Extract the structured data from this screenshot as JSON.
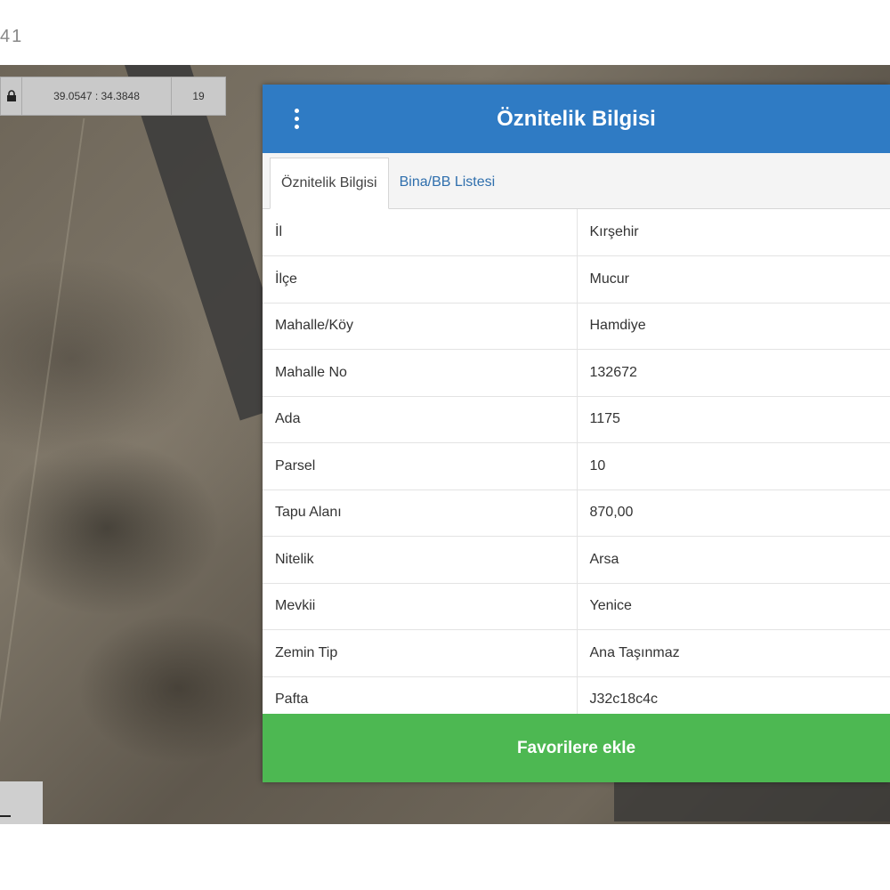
{
  "corner_label": "41",
  "map": {
    "coordinates": "39.0547 : 34.3848",
    "zoom_level": "19",
    "lock_icon": "lock-icon"
  },
  "panel": {
    "title": "Öznitelik Bilgisi",
    "menu_icon": "vertical-dots-icon",
    "tabs": [
      {
        "label": "Öznitelik Bilgisi",
        "active": true
      },
      {
        "label": "Bina/BB Listesi",
        "active": false
      }
    ],
    "rows": [
      {
        "key": "İl",
        "value": "Kırşehir"
      },
      {
        "key": "İlçe",
        "value": "Mucur"
      },
      {
        "key": "Mahalle/Köy",
        "value": "Hamdiye"
      },
      {
        "key": "Mahalle No",
        "value": "132672"
      },
      {
        "key": "Ada",
        "value": "1175"
      },
      {
        "key": "Parsel",
        "value": "10"
      },
      {
        "key": "Tapu Alanı",
        "value": "870,00"
      },
      {
        "key": "Nitelik",
        "value": "Arsa"
      },
      {
        "key": "Mevkii",
        "value": "Yenice"
      },
      {
        "key": "Zemin Tip",
        "value": "Ana Taşınmaz"
      },
      {
        "key": "Pafta",
        "value": "J32c18c4c"
      }
    ],
    "favorite_button": "Favorilere ekle"
  },
  "colors": {
    "header_blue": "#2f7bc4",
    "button_green": "#4db852"
  }
}
